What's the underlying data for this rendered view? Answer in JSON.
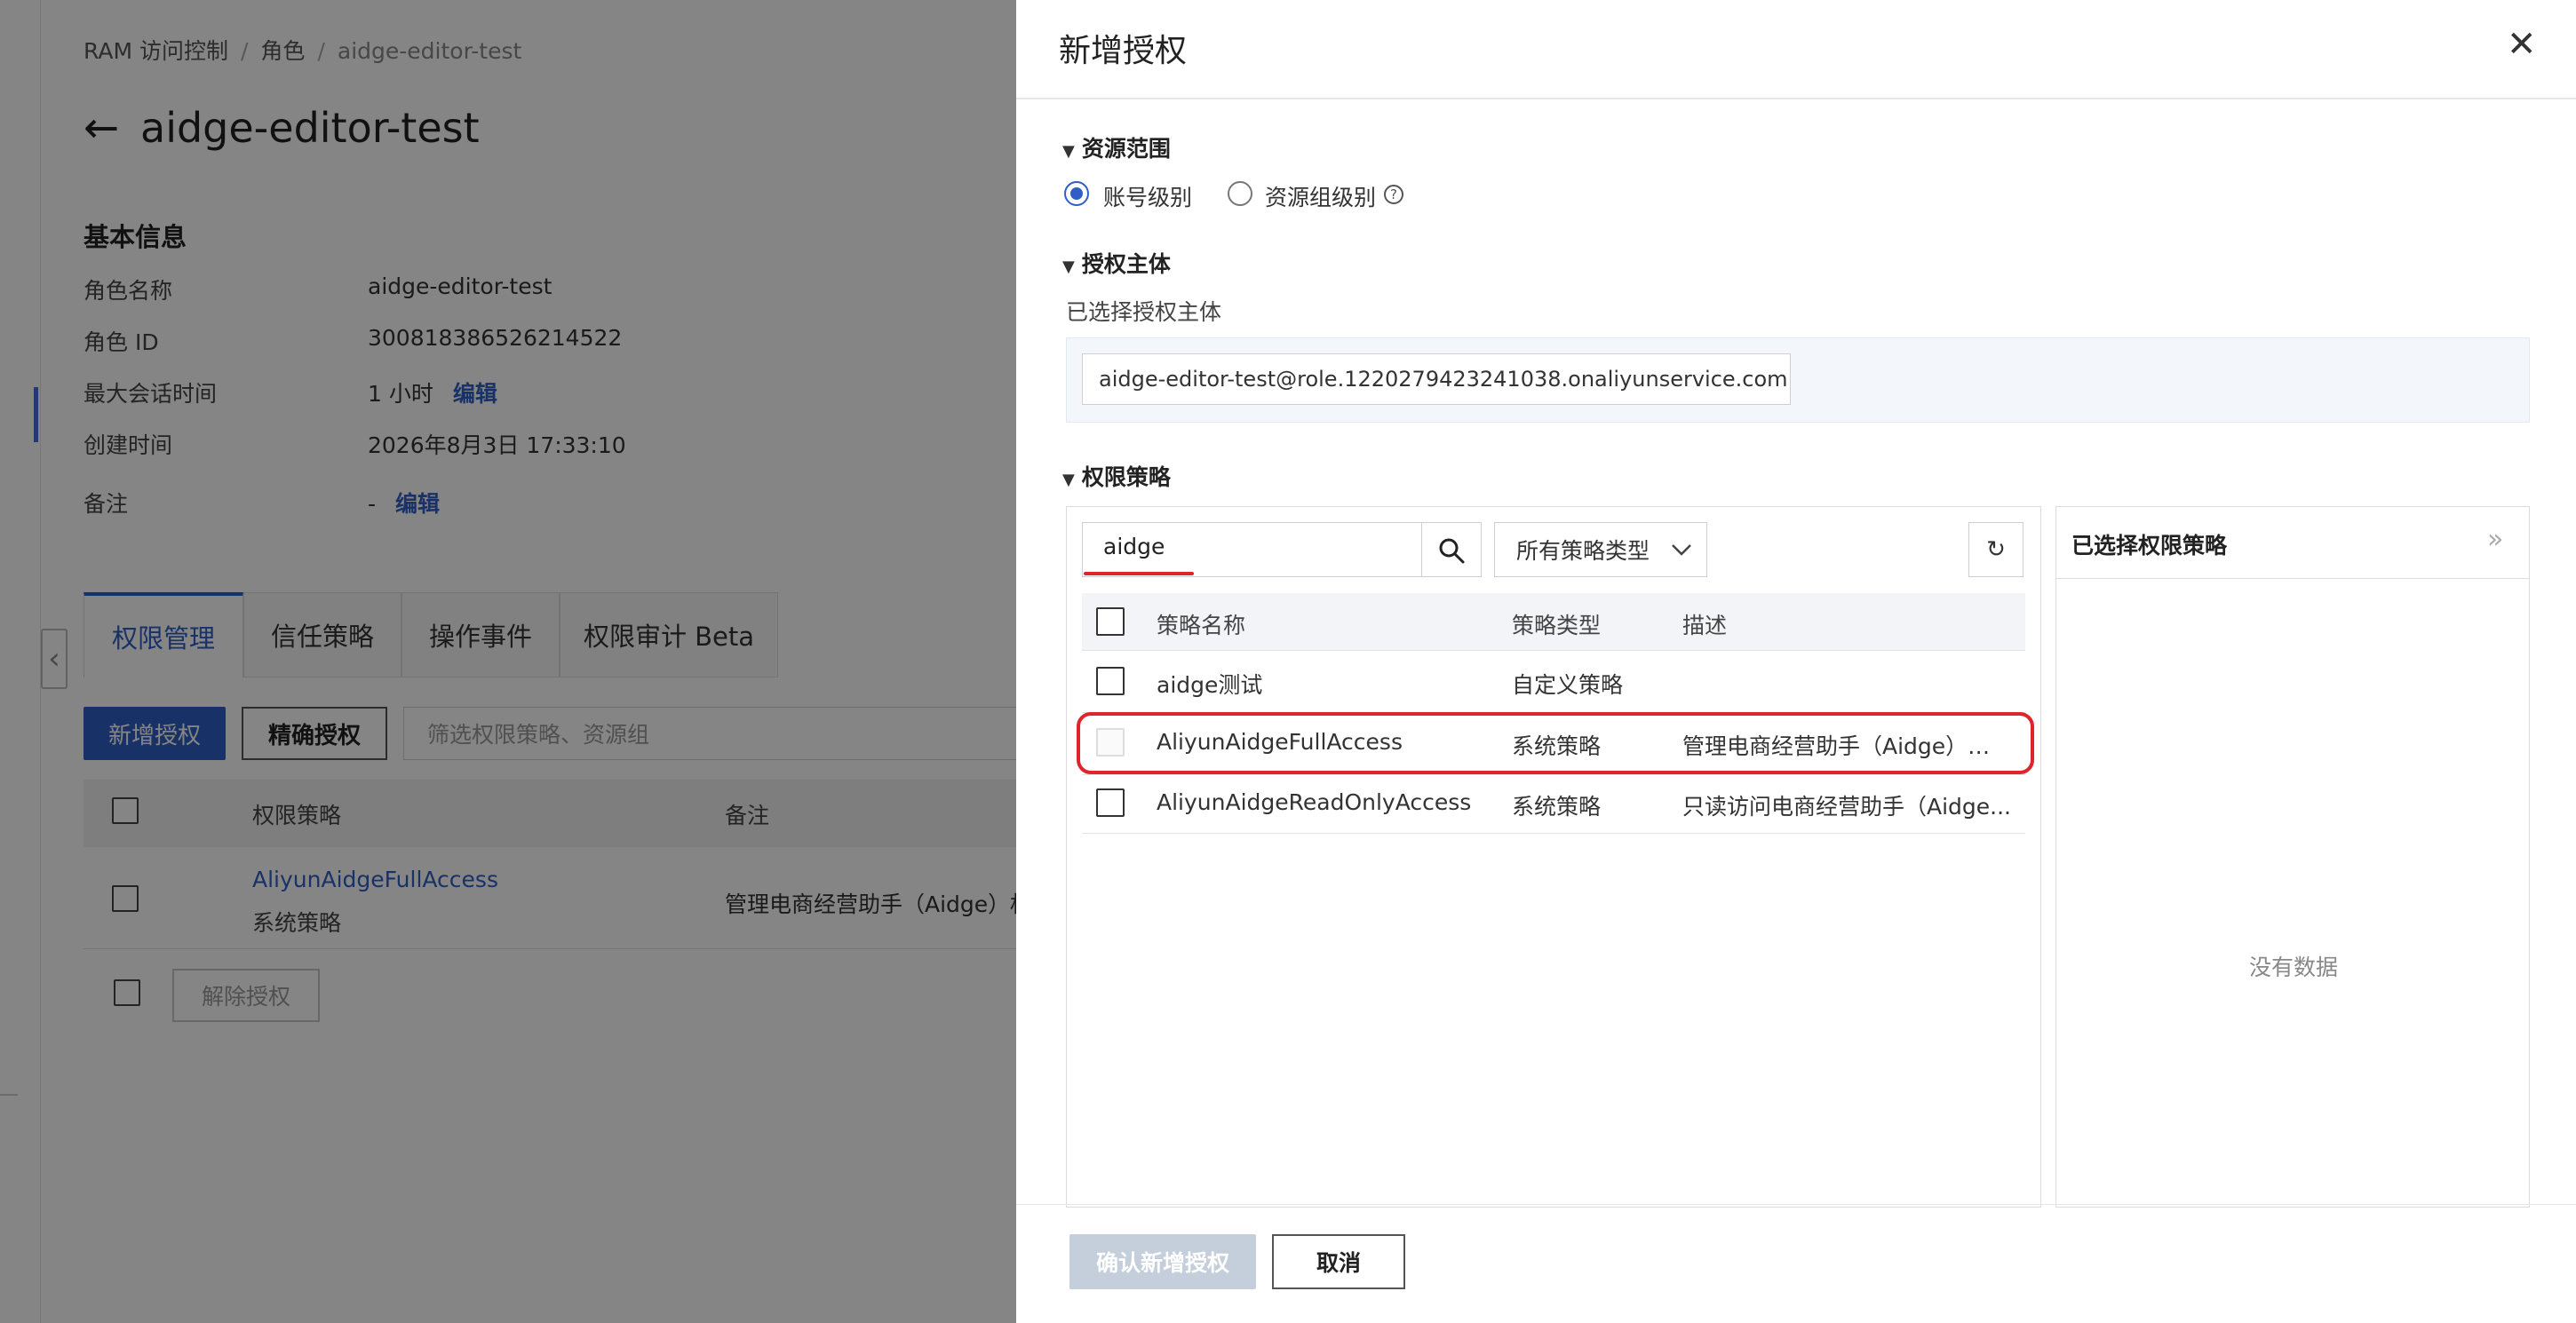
{
  "breadcrumb": [
    "RAM 访问控制",
    "角色",
    "aidge-editor-test"
  ],
  "page_title": "aidge-editor-test",
  "basic_info": {
    "title": "基本信息",
    "rows": [
      {
        "label": "角色名称",
        "value": "aidge-editor-test",
        "link": ""
      },
      {
        "label": "角色 ID",
        "value": "300818386526214522",
        "link": ""
      },
      {
        "label": "最大会话时间",
        "value": "1 小时",
        "link": "编辑"
      },
      {
        "label": "创建时间",
        "value": "2026年8月3日 17:33:10",
        "link": ""
      },
      {
        "label": "备注",
        "value": "-",
        "link": "编辑"
      }
    ]
  },
  "tabs": [
    "权限管理",
    "信任策略",
    "操作事件",
    "权限审计 Beta"
  ],
  "toolbar": {
    "add_label": "新增授权",
    "precise_label": "精确授权",
    "filter_placeholder": "筛选权限策略、资源组"
  },
  "bg_table": {
    "headers": [
      "权限策略",
      "备注"
    ],
    "row": {
      "name": "AliyunAidgeFullAccess",
      "type": "系统策略",
      "desc": "管理电商经营助手（Aidge）权"
    },
    "revoke_label": "解除授权"
  },
  "drawer": {
    "title": "新增授权",
    "scope": {
      "title": "资源范围",
      "options": [
        "账号级别",
        "资源组级别"
      ],
      "selected": "账号级别"
    },
    "principal": {
      "title": "授权主体",
      "label": "已选择授权主体",
      "value": "aidge-editor-test@role.1220279423241038.onaliyunservice.com"
    },
    "policies": {
      "title": "权限策略",
      "search_value": "aidge",
      "type_select": "所有策略类型",
      "headers": [
        "策略名称",
        "策略类型",
        "描述"
      ],
      "rows": [
        {
          "name": "aidge测试",
          "type": "自定义策略",
          "desc": ""
        },
        {
          "name": "AliyunAidgeFullAccess",
          "type": "系统策略",
          "desc": "管理电商经营助手（Aidge）权限"
        },
        {
          "name": "AliyunAidgeReadOnlyAccess",
          "type": "系统策略",
          "desc": "只读访问电商经营助手（Aidge..."
        }
      ]
    },
    "selected_panel": {
      "title": "已选择权限策略",
      "empty": "没有数据"
    },
    "confirm_label": "确认新增授权",
    "cancel_label": "取消"
  },
  "colors": {
    "accent": "#2f5fc4",
    "highlight": "#e0242c",
    "overlay": "rgba(0,0,0,0.48)"
  }
}
